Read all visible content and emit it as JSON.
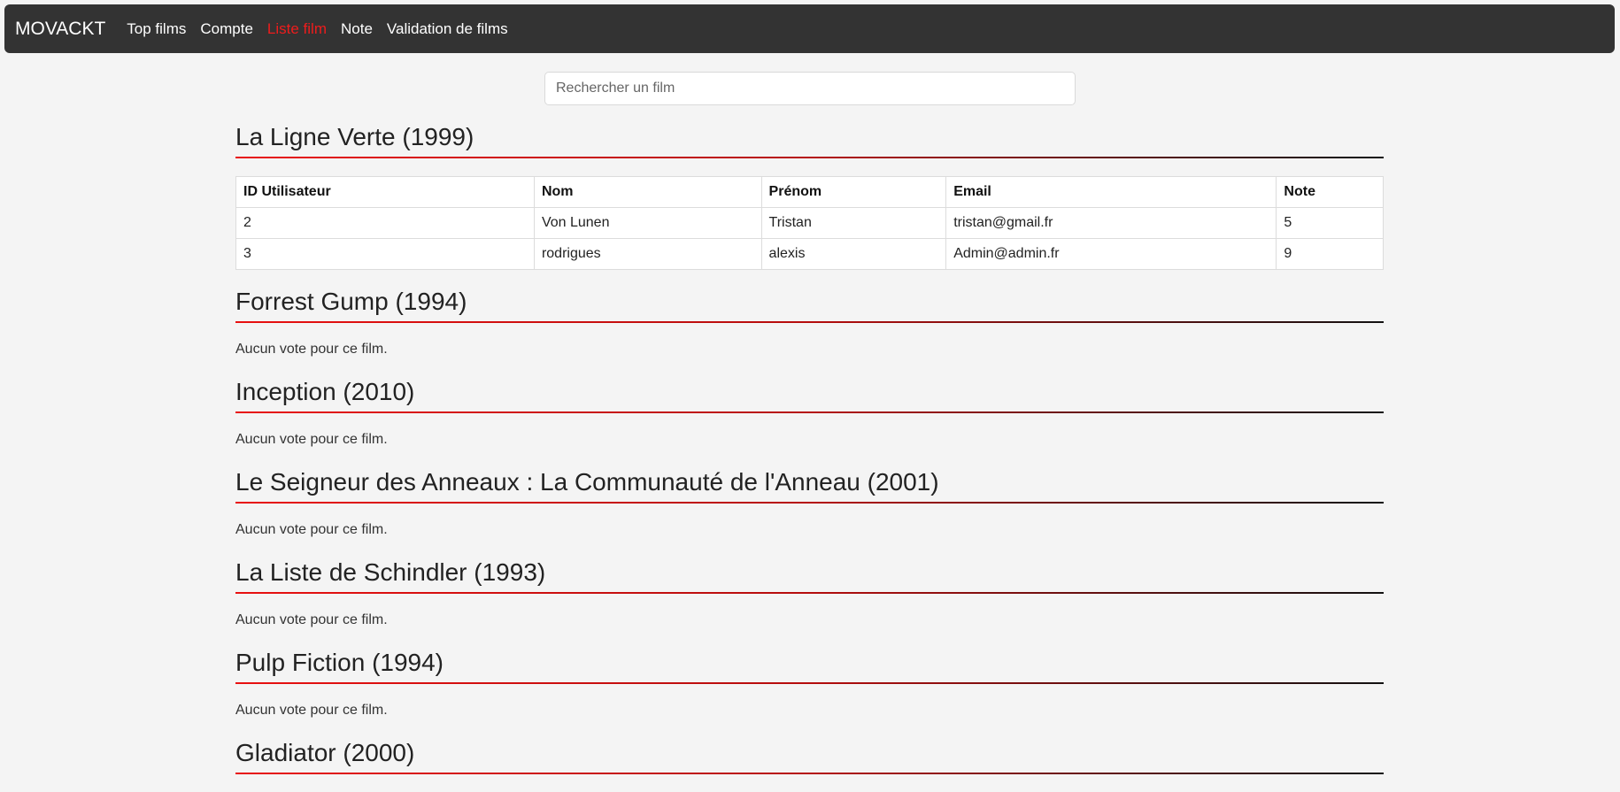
{
  "nav": {
    "brand": "MOVACKT",
    "links": [
      {
        "label": "Top films",
        "active": false
      },
      {
        "label": "Compte",
        "active": false
      },
      {
        "label": "Liste film",
        "active": true
      },
      {
        "label": "Note",
        "active": false
      },
      {
        "label": "Validation de films",
        "active": false
      }
    ]
  },
  "search": {
    "placeholder": "Rechercher un film",
    "value": ""
  },
  "table_headers": [
    "ID Utilisateur",
    "Nom",
    "Prénom",
    "Email",
    "Note"
  ],
  "films": [
    {
      "title": "La Ligne Verte (1999)",
      "votes": [
        [
          "2",
          "Von Lunen",
          "Tristan",
          "tristan@gmail.fr",
          "5"
        ],
        [
          "3",
          "rodrigues",
          "alexis",
          "Admin@admin.fr",
          "9"
        ]
      ]
    },
    {
      "title": "Forrest Gump (1994)",
      "no_vote": "Aucun vote pour ce film."
    },
    {
      "title": "Inception (2010)",
      "no_vote": "Aucun vote pour ce film."
    },
    {
      "title": "Le Seigneur des Anneaux : La Communauté de l'Anneau (2001)",
      "no_vote": "Aucun vote pour ce film."
    },
    {
      "title": "La Liste de Schindler (1993)",
      "no_vote": "Aucun vote pour ce film."
    },
    {
      "title": "Pulp Fiction (1994)",
      "no_vote": "Aucun vote pour ce film."
    },
    {
      "title": "Gladiator (2000)",
      "no_vote": ""
    }
  ],
  "colors": {
    "navbar": "#333333",
    "accent": "#ee1c1c",
    "background": "#f4f4f4"
  }
}
